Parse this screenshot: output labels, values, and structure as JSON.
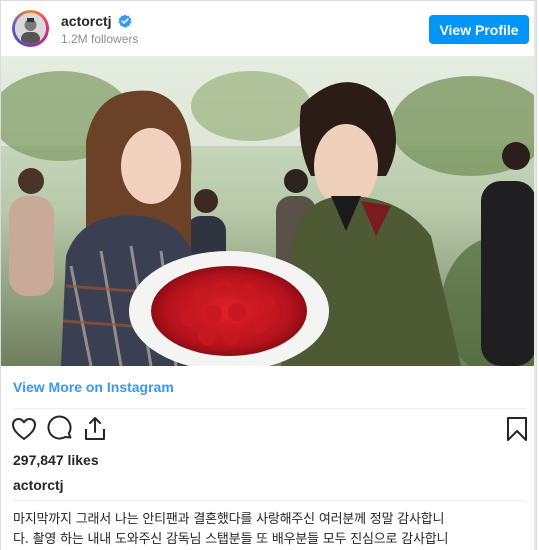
{
  "header": {
    "username": "actorctj",
    "followers": "1.2M followers",
    "view_profile_label": "View Profile",
    "verified_icon": "verified-badge-icon"
  },
  "post": {
    "view_more_label": "View More on Instagram",
    "likes": "297,847 likes",
    "caption_username": "actorctj",
    "caption_line1": "마지막까지 그래서 나는 안티팬과 결혼했다를 사랑해주신 여러분께 정말 감사합니",
    "caption_line2": "다. 촬영 하는 내내 도와주신 감독님 스탭분들 또 배우분들 모두 진심으로 감사합니"
  },
  "actions": {
    "like_icon": "heart-icon",
    "comment_icon": "comment-icon",
    "share_icon": "share-icon",
    "save_icon": "bookmark-icon"
  },
  "colors": {
    "accent": "#0095f6",
    "link": "#3897f0",
    "text": "#262626",
    "muted": "#8e8e8e"
  }
}
